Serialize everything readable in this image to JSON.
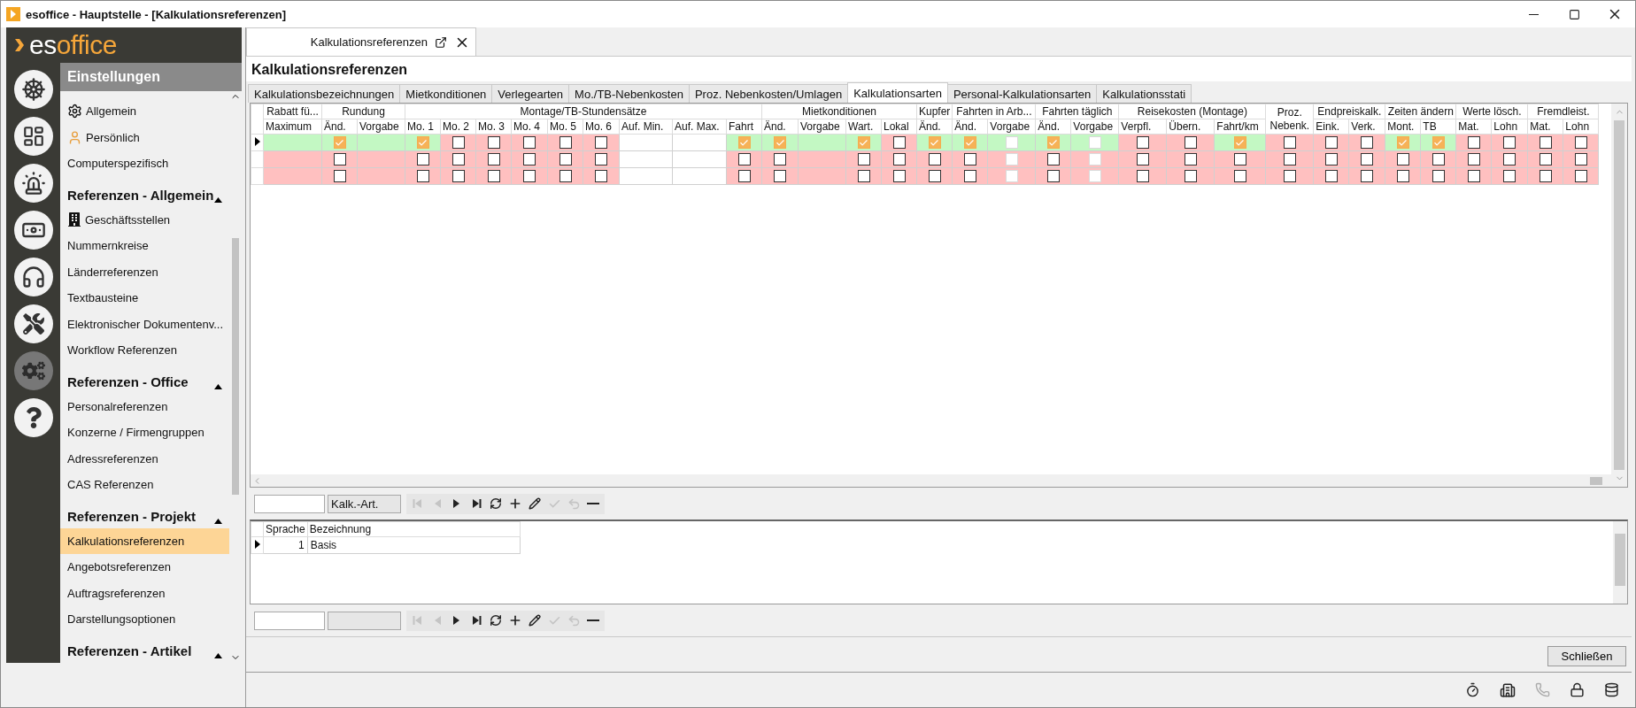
{
  "window": {
    "title": "esoffice - Hauptstelle - [Kalkulationsreferenzen]"
  },
  "logo": {
    "prefix": "es",
    "suffix": "office"
  },
  "rail": [
    {
      "kind": "wheel",
      "selected": false
    },
    {
      "kind": "board",
      "selected": false
    },
    {
      "kind": "siren",
      "selected": false
    },
    {
      "kind": "money",
      "selected": false
    },
    {
      "kind": "headset",
      "selected": false
    },
    {
      "kind": "tools",
      "selected": false
    },
    {
      "kind": "gears",
      "selected": true
    },
    {
      "kind": "help",
      "selected": false
    }
  ],
  "sidebar": {
    "title": "Einstellungen",
    "items": [
      {
        "label": "Allgemein",
        "kind": "gears",
        "selected": false
      },
      {
        "label": "Persönlich",
        "kind": "gears-person",
        "selected": false
      },
      {
        "label": "Computerspezifisch",
        "kind": "plain",
        "selected": false
      }
    ],
    "sections": [
      {
        "title": "Referenzen - Allgemein",
        "expanded": true,
        "items": [
          {
            "label": "Geschäftsstellen",
            "kind": "building",
            "selected": false
          },
          {
            "label": "Nummernkreise",
            "kind": "plain",
            "selected": false
          },
          {
            "label": "Länderreferenzen",
            "kind": "plain",
            "selected": false
          },
          {
            "label": "Textbausteine",
            "kind": "plain",
            "selected": false
          },
          {
            "label": "Elektronischer Dokumentenv...",
            "kind": "plain",
            "selected": false
          },
          {
            "label": "Workflow Referenzen",
            "kind": "plain",
            "selected": false
          }
        ]
      },
      {
        "title": "Referenzen - Office",
        "expanded": true,
        "items": [
          {
            "label": "Personalreferenzen",
            "kind": "plain",
            "selected": false
          },
          {
            "label": "Konzerne / Firmengruppen",
            "kind": "plain",
            "selected": false
          },
          {
            "label": "Adressreferenzen",
            "kind": "plain",
            "selected": false
          },
          {
            "label": "CAS Referenzen",
            "kind": "plain",
            "selected": false
          }
        ]
      },
      {
        "title": "Referenzen - Projekt",
        "expanded": true,
        "items": [
          {
            "label": "Kalkulationsreferenzen",
            "kind": "plain",
            "selected": true
          },
          {
            "label": "Angebotsreferenzen",
            "kind": "plain",
            "selected": false
          },
          {
            "label": "Auftragsreferenzen",
            "kind": "plain",
            "selected": false
          },
          {
            "label": "Darstellungsoptionen",
            "kind": "plain",
            "selected": false
          }
        ]
      },
      {
        "title": "Referenzen - Artikel",
        "expanded": true
      }
    ]
  },
  "document_tab": {
    "label": "Kalkulationsreferenzen"
  },
  "heading": "Kalkulationsreferenzen",
  "tabs": [
    {
      "label": "Kalkulationsbezeichnungen",
      "selected": false
    },
    {
      "label": "Mietkonditionen",
      "selected": false
    },
    {
      "label": "Verlegearten",
      "selected": false
    },
    {
      "label": "Mo./TB-Nebenkosten",
      "selected": false
    },
    {
      "label": "Proz. Nebenkosten/Umlagen",
      "selected": false
    },
    {
      "label": "Kalkulationsarten",
      "selected": true
    },
    {
      "label": "Personal-Kalkulationsarten",
      "selected": false
    },
    {
      "label": "Kalkulationsstati",
      "selected": false
    }
  ],
  "grid": {
    "groups": [
      {
        "label": "Rabatt fü...",
        "columns": [
          "Maximum"
        ]
      },
      {
        "label": "Rundung",
        "columns": [
          "Änd.",
          "Vorgabe"
        ]
      },
      {
        "label": "Montage/TB-Stundensätze",
        "columns": [
          "Mo. 1",
          "Mo. 2",
          "Mo. 3",
          "Mo. 4",
          "Mo. 5",
          "Mo. 6",
          "Auf. Min.",
          "Auf. Max.",
          "Fahrt"
        ]
      },
      {
        "label": "Mietkonditionen",
        "columns": [
          "Änd.",
          "Vorgabe",
          "Wart.",
          "Lokal"
        ]
      },
      {
        "label": "Kupfer",
        "columns": [
          "Änd."
        ]
      },
      {
        "label": "Fahrten in Arb...",
        "columns": [
          "Änd.",
          "Vorgabe"
        ]
      },
      {
        "label": "Fahrten täglich",
        "columns": [
          "Änd.",
          "Vorgabe"
        ]
      },
      {
        "label": "Reisekosten (Montage)",
        "columns": [
          "Verpfl.",
          "Übern.",
          "Fahrt/km"
        ]
      },
      {
        "label": "Proz. Nebenk."
      },
      {
        "label": "Endpreiskalk.",
        "columns": [
          "Eink.",
          "Verk."
        ]
      },
      {
        "label": "Zeiten ändern",
        "columns": [
          "Mont.",
          "TB"
        ]
      },
      {
        "label": "Werte lösch.",
        "columns": [
          "Mat.",
          "Lohn"
        ]
      },
      {
        "label": "Fremdleist.",
        "columns": [
          "Mat.",
          "Lohn"
        ]
      }
    ],
    "rows": [
      {
        "selected": true,
        "cells": [
          {
            "kind": "blank",
            "valid": true
          },
          {
            "kind": "check",
            "checked": true,
            "valid": true
          },
          {
            "kind": "blank",
            "valid": true
          },
          {
            "kind": "check",
            "checked": true,
            "valid": true
          },
          {
            "kind": "check",
            "checked": false,
            "valid": false
          },
          {
            "kind": "check",
            "checked": false,
            "valid": false
          },
          {
            "kind": "check",
            "checked": false,
            "valid": false
          },
          {
            "kind": "check",
            "checked": false,
            "valid": false
          },
          {
            "kind": "check",
            "checked": false,
            "valid": false
          },
          {
            "kind": "field"
          },
          {
            "kind": "field"
          },
          {
            "kind": "check",
            "checked": true,
            "valid": true
          },
          {
            "kind": "check",
            "checked": true,
            "valid": true
          },
          {
            "kind": "blank",
            "valid": true
          },
          {
            "kind": "check",
            "checked": true,
            "valid": true
          },
          {
            "kind": "check",
            "checked": false,
            "valid": false
          },
          {
            "kind": "check",
            "checked": true,
            "valid": true
          },
          {
            "kind": "check",
            "checked": true,
            "valid": true
          },
          {
            "kind": "locked",
            "valid": true
          },
          {
            "kind": "check",
            "checked": true,
            "valid": true
          },
          {
            "kind": "locked",
            "valid": true
          },
          {
            "kind": "check",
            "checked": false,
            "valid": false
          },
          {
            "kind": "check",
            "checked": false,
            "valid": false
          },
          {
            "kind": "check",
            "checked": true,
            "valid": true
          },
          {
            "kind": "check",
            "checked": false,
            "valid": false
          },
          {
            "kind": "check",
            "checked": false,
            "valid": false
          },
          {
            "kind": "check",
            "checked": false,
            "valid": false
          },
          {
            "kind": "check",
            "checked": true,
            "valid": true
          },
          {
            "kind": "check",
            "checked": true,
            "valid": true
          },
          {
            "kind": "check",
            "checked": false,
            "valid": false
          },
          {
            "kind": "check",
            "checked": false,
            "valid": false
          },
          {
            "kind": "check",
            "checked": false,
            "valid": false
          },
          {
            "kind": "check",
            "checked": false,
            "valid": false
          }
        ]
      },
      {
        "selected": false,
        "cells": [
          {
            "kind": "blank",
            "valid": false
          },
          {
            "kind": "check",
            "checked": false,
            "valid": false
          },
          {
            "kind": "blank",
            "valid": false
          },
          {
            "kind": "check",
            "checked": false,
            "valid": false
          },
          {
            "kind": "check",
            "checked": false,
            "valid": false
          },
          {
            "kind": "check",
            "checked": false,
            "valid": false
          },
          {
            "kind": "check",
            "checked": false,
            "valid": false
          },
          {
            "kind": "check",
            "checked": false,
            "valid": false
          },
          {
            "kind": "check",
            "checked": false,
            "valid": false
          },
          {
            "kind": "field"
          },
          {
            "kind": "field"
          },
          {
            "kind": "check",
            "checked": false,
            "valid": false
          },
          {
            "kind": "check",
            "checked": false,
            "valid": false
          },
          {
            "kind": "blank",
            "valid": false
          },
          {
            "kind": "check",
            "checked": false,
            "valid": false
          },
          {
            "kind": "check",
            "checked": false,
            "valid": false
          },
          {
            "kind": "check",
            "checked": false,
            "valid": false
          },
          {
            "kind": "check",
            "checked": false,
            "valid": false
          },
          {
            "kind": "locked",
            "valid": false
          },
          {
            "kind": "check",
            "checked": false,
            "valid": false
          },
          {
            "kind": "locked",
            "valid": false
          },
          {
            "kind": "check",
            "checked": false,
            "valid": false
          },
          {
            "kind": "check",
            "checked": false,
            "valid": false
          },
          {
            "kind": "check",
            "checked": false,
            "valid": false
          },
          {
            "kind": "check",
            "checked": false,
            "valid": false
          },
          {
            "kind": "check",
            "checked": false,
            "valid": false
          },
          {
            "kind": "check",
            "checked": false,
            "valid": false
          },
          {
            "kind": "check",
            "checked": false,
            "valid": false
          },
          {
            "kind": "check",
            "checked": false,
            "valid": false
          },
          {
            "kind": "check",
            "checked": false,
            "valid": false
          },
          {
            "kind": "check",
            "checked": false,
            "valid": false
          },
          {
            "kind": "check",
            "checked": false,
            "valid": false
          },
          {
            "kind": "check",
            "checked": false,
            "valid": false
          }
        ]
      },
      {
        "selected": false,
        "cells": [
          {
            "kind": "blank",
            "valid": false
          },
          {
            "kind": "check",
            "checked": false,
            "valid": false
          },
          {
            "kind": "blank",
            "valid": false
          },
          {
            "kind": "check",
            "checked": false,
            "valid": false
          },
          {
            "kind": "check",
            "checked": false,
            "valid": false
          },
          {
            "kind": "check",
            "checked": false,
            "valid": false
          },
          {
            "kind": "check",
            "checked": false,
            "valid": false
          },
          {
            "kind": "check",
            "checked": false,
            "valid": false
          },
          {
            "kind": "check",
            "checked": false,
            "valid": false
          },
          {
            "kind": "field"
          },
          {
            "kind": "field"
          },
          {
            "kind": "check",
            "checked": false,
            "valid": false
          },
          {
            "kind": "check",
            "checked": false,
            "valid": false
          },
          {
            "kind": "blank",
            "valid": false
          },
          {
            "kind": "check",
            "checked": false,
            "valid": false
          },
          {
            "kind": "check",
            "checked": false,
            "valid": false
          },
          {
            "kind": "check",
            "checked": false,
            "valid": false
          },
          {
            "kind": "check",
            "checked": false,
            "valid": false
          },
          {
            "kind": "locked",
            "valid": false
          },
          {
            "kind": "check",
            "checked": false,
            "valid": false
          },
          {
            "kind": "locked",
            "valid": false
          },
          {
            "kind": "check",
            "checked": false,
            "valid": false
          },
          {
            "kind": "check",
            "checked": false,
            "valid": false
          },
          {
            "kind": "check",
            "checked": false,
            "valid": false
          },
          {
            "kind": "check",
            "checked": false,
            "valid": false
          },
          {
            "kind": "check",
            "checked": false,
            "valid": false
          },
          {
            "kind": "check",
            "checked": false,
            "valid": false
          },
          {
            "kind": "check",
            "checked": false,
            "valid": false
          },
          {
            "kind": "check",
            "checked": false,
            "valid": false
          },
          {
            "kind": "check",
            "checked": false,
            "valid": false
          },
          {
            "kind": "check",
            "checked": false,
            "valid": false
          },
          {
            "kind": "check",
            "checked": false,
            "valid": false
          },
          {
            "kind": "check",
            "checked": false,
            "valid": false
          }
        ]
      }
    ]
  },
  "navigator": {
    "field": "Kalk.-Art.",
    "buttons": [
      {
        "kind": "first",
        "disabled": true
      },
      {
        "kind": "prev",
        "disabled": true
      },
      {
        "kind": "next",
        "disabled": false
      },
      {
        "kind": "last",
        "disabled": false
      },
      {
        "kind": "refresh",
        "disabled": false
      },
      {
        "kind": "add",
        "disabled": false
      },
      {
        "kind": "edit",
        "disabled": false
      },
      {
        "kind": "confirm",
        "disabled": true
      },
      {
        "kind": "undo",
        "disabled": true
      },
      {
        "kind": "delete",
        "disabled": false
      }
    ]
  },
  "detail_grid": {
    "columns": [
      "Sprache",
      "Bezeichnung"
    ],
    "rows": [
      {
        "selected": true,
        "cells": [
          "1",
          "Basis"
        ]
      }
    ]
  },
  "detail_navigator": {
    "buttons": [
      {
        "kind": "first",
        "disabled": true
      },
      {
        "kind": "prev",
        "disabled": true
      },
      {
        "kind": "next",
        "disabled": false
      },
      {
        "kind": "last",
        "disabled": false
      },
      {
        "kind": "refresh",
        "disabled": false
      },
      {
        "kind": "add",
        "disabled": false
      },
      {
        "kind": "edit",
        "disabled": false
      },
      {
        "kind": "confirm",
        "disabled": true
      },
      {
        "kind": "undo",
        "disabled": true
      },
      {
        "kind": "delete",
        "disabled": false
      }
    ]
  },
  "buttons": [
    {
      "label": "Schließen"
    }
  ]
}
